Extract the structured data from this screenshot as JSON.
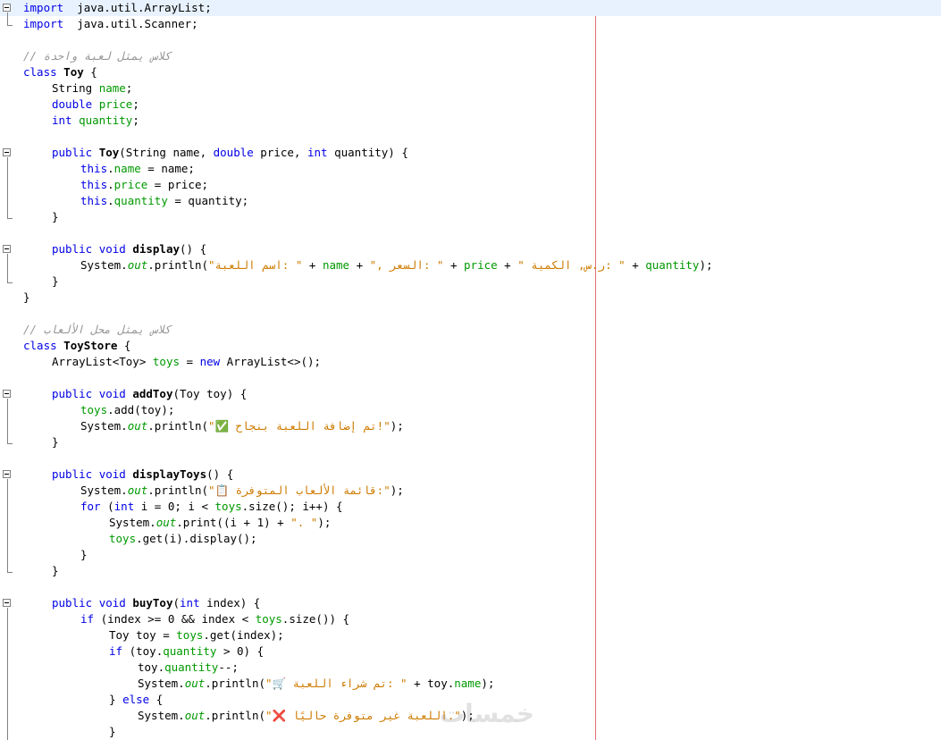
{
  "editor": {
    "lines": [
      {
        "indent": 0,
        "spans": [
          [
            "kw",
            "import"
          ],
          [
            "",
            "  java.util.ArrayList;"
          ]
        ]
      },
      {
        "indent": 0,
        "spans": [
          [
            "kw",
            "import"
          ],
          [
            "",
            "  java.util.Scanner;"
          ]
        ]
      },
      {
        "indent": 0,
        "spans": []
      },
      {
        "indent": 0,
        "spans": [
          [
            "cmt",
            "// كلاس يمثل لعبة واحدة"
          ]
        ]
      },
      {
        "indent": 0,
        "spans": [
          [
            "kw",
            "class"
          ],
          [
            "",
            " "
          ],
          [
            "b",
            "Toy"
          ],
          [
            "",
            " {"
          ]
        ]
      },
      {
        "indent": 1,
        "spans": [
          [
            "",
            "String "
          ],
          [
            "fld",
            "name"
          ],
          [
            "",
            ";"
          ]
        ]
      },
      {
        "indent": 1,
        "spans": [
          [
            "kw",
            "double"
          ],
          [
            "",
            " "
          ],
          [
            "fld",
            "price"
          ],
          [
            "",
            ";"
          ]
        ]
      },
      {
        "indent": 1,
        "spans": [
          [
            "kw",
            "int"
          ],
          [
            "",
            " "
          ],
          [
            "fld",
            "quantity"
          ],
          [
            "",
            ";"
          ]
        ]
      },
      {
        "indent": 0,
        "spans": []
      },
      {
        "indent": 1,
        "spans": [
          [
            "kw",
            "public"
          ],
          [
            "",
            " "
          ],
          [
            "b",
            "Toy"
          ],
          [
            "",
            "(String name, "
          ],
          [
            "kw",
            "double"
          ],
          [
            "",
            " price, "
          ],
          [
            "kw",
            "int"
          ],
          [
            "",
            " quantity) {"
          ]
        ]
      },
      {
        "indent": 2,
        "spans": [
          [
            "kw",
            "this"
          ],
          [
            "",
            "."
          ],
          [
            "fld",
            "name"
          ],
          [
            "",
            " = name;"
          ]
        ]
      },
      {
        "indent": 2,
        "spans": [
          [
            "kw",
            "this"
          ],
          [
            "",
            "."
          ],
          [
            "fld",
            "price"
          ],
          [
            "",
            " = price;"
          ]
        ]
      },
      {
        "indent": 2,
        "spans": [
          [
            "kw",
            "this"
          ],
          [
            "",
            "."
          ],
          [
            "fld",
            "quantity"
          ],
          [
            "",
            " = quantity;"
          ]
        ]
      },
      {
        "indent": 1,
        "spans": [
          [
            "",
            "}"
          ]
        ]
      },
      {
        "indent": 0,
        "spans": []
      },
      {
        "indent": 1,
        "spans": [
          [
            "kw",
            "public"
          ],
          [
            "",
            " "
          ],
          [
            "kw",
            "void"
          ],
          [
            "",
            " "
          ],
          [
            "b",
            "display"
          ],
          [
            "",
            "() {"
          ]
        ]
      },
      {
        "indent": 2,
        "spans": [
          [
            "",
            "System."
          ],
          [
            "sm",
            "out"
          ],
          [
            "",
            ".println("
          ],
          [
            "str",
            "\"اسم اللعبة: \""
          ],
          [
            "",
            " + "
          ],
          [
            "fld",
            "name"
          ],
          [
            "",
            " + "
          ],
          [
            "str",
            "\", السعر: \""
          ],
          [
            "",
            " + "
          ],
          [
            "fld",
            "price"
          ],
          [
            "",
            " + "
          ],
          [
            "str",
            "\" ر.س, الكمية: \""
          ],
          [
            "",
            " + "
          ],
          [
            "fld",
            "quantity"
          ],
          [
            "",
            ");"
          ]
        ]
      },
      {
        "indent": 1,
        "spans": [
          [
            "",
            "}"
          ]
        ]
      },
      {
        "indent": 0,
        "spans": [
          [
            "",
            "}"
          ]
        ]
      },
      {
        "indent": 0,
        "spans": []
      },
      {
        "indent": 0,
        "spans": [
          [
            "cmt",
            "// كلاس يمثل محل الألعاب"
          ]
        ]
      },
      {
        "indent": 0,
        "spans": [
          [
            "kw",
            "class"
          ],
          [
            "",
            " "
          ],
          [
            "b",
            "ToyStore"
          ],
          [
            "",
            " {"
          ]
        ]
      },
      {
        "indent": 1,
        "spans": [
          [
            "",
            "ArrayList<Toy> "
          ],
          [
            "fld",
            "toys"
          ],
          [
            "",
            " = "
          ],
          [
            "kw",
            "new"
          ],
          [
            "",
            " ArrayList<>();"
          ]
        ]
      },
      {
        "indent": 0,
        "spans": []
      },
      {
        "indent": 1,
        "spans": [
          [
            "kw",
            "public"
          ],
          [
            "",
            " "
          ],
          [
            "kw",
            "void"
          ],
          [
            "",
            " "
          ],
          [
            "b",
            "addToy"
          ],
          [
            "",
            "(Toy toy) {"
          ]
        ]
      },
      {
        "indent": 2,
        "spans": [
          [
            "fld",
            "toys"
          ],
          [
            "",
            ".add(toy);"
          ]
        ]
      },
      {
        "indent": 2,
        "spans": [
          [
            "",
            "System."
          ],
          [
            "sm",
            "out"
          ],
          [
            "",
            ".println("
          ],
          [
            "str",
            "\"✅ تم إضافة اللعبة بنجاح!\""
          ],
          [
            "",
            ");"
          ]
        ]
      },
      {
        "indent": 1,
        "spans": [
          [
            "",
            "}"
          ]
        ]
      },
      {
        "indent": 0,
        "spans": []
      },
      {
        "indent": 1,
        "spans": [
          [
            "kw",
            "public"
          ],
          [
            "",
            " "
          ],
          [
            "kw",
            "void"
          ],
          [
            "",
            " "
          ],
          [
            "b",
            "displayToys"
          ],
          [
            "",
            "() {"
          ]
        ]
      },
      {
        "indent": 2,
        "spans": [
          [
            "",
            "System."
          ],
          [
            "sm",
            "out"
          ],
          [
            "",
            ".println("
          ],
          [
            "str",
            "\"📋 قائمة الألعاب المتوفرة:\""
          ],
          [
            "",
            ");"
          ]
        ]
      },
      {
        "indent": 2,
        "spans": [
          [
            "kw",
            "for"
          ],
          [
            "",
            " ("
          ],
          [
            "kw",
            "int"
          ],
          [
            "",
            " i = 0; i < "
          ],
          [
            "fld",
            "toys"
          ],
          [
            "",
            ".size(); i++) {"
          ]
        ]
      },
      {
        "indent": 3,
        "spans": [
          [
            "",
            "System."
          ],
          [
            "sm",
            "out"
          ],
          [
            "",
            ".print((i + 1) + "
          ],
          [
            "str",
            "\". \""
          ],
          [
            "",
            ");"
          ]
        ]
      },
      {
        "indent": 3,
        "spans": [
          [
            "fld",
            "toys"
          ],
          [
            "",
            ".get(i).display();"
          ]
        ]
      },
      {
        "indent": 2,
        "spans": [
          [
            "",
            "}"
          ]
        ]
      },
      {
        "indent": 1,
        "spans": [
          [
            "",
            "}"
          ]
        ]
      },
      {
        "indent": 0,
        "spans": []
      },
      {
        "indent": 1,
        "spans": [
          [
            "kw",
            "public"
          ],
          [
            "",
            " "
          ],
          [
            "kw",
            "void"
          ],
          [
            "",
            " "
          ],
          [
            "b",
            "buyToy"
          ],
          [
            "",
            "("
          ],
          [
            "kw",
            "int"
          ],
          [
            "",
            " index) {"
          ]
        ]
      },
      {
        "indent": 2,
        "spans": [
          [
            "kw",
            "if"
          ],
          [
            "",
            " (index >= 0 && index < "
          ],
          [
            "fld",
            "toys"
          ],
          [
            "",
            ".size()) {"
          ]
        ]
      },
      {
        "indent": 3,
        "spans": [
          [
            "",
            "Toy toy = "
          ],
          [
            "fld",
            "toys"
          ],
          [
            "",
            ".get(index);"
          ]
        ]
      },
      {
        "indent": 3,
        "spans": [
          [
            "kw",
            "if"
          ],
          [
            "",
            " (toy."
          ],
          [
            "fld",
            "quantity"
          ],
          [
            "",
            " > 0) {"
          ]
        ]
      },
      {
        "indent": 4,
        "spans": [
          [
            "",
            "toy."
          ],
          [
            "fld",
            "quantity"
          ],
          [
            "",
            "--;"
          ]
        ]
      },
      {
        "indent": 4,
        "spans": [
          [
            "",
            "System."
          ],
          [
            "sm",
            "out"
          ],
          [
            "",
            ".println("
          ],
          [
            "str",
            "\"🛒 تم شراء اللعبة: \""
          ],
          [
            "",
            " + toy."
          ],
          [
            "fld",
            "name"
          ],
          [
            "",
            ");"
          ]
        ]
      },
      {
        "indent": 3,
        "spans": [
          [
            "",
            "} "
          ],
          [
            "kw",
            "else"
          ],
          [
            "",
            " {"
          ]
        ]
      },
      {
        "indent": 4,
        "spans": [
          [
            "",
            "System."
          ],
          [
            "sm",
            "out"
          ],
          [
            "",
            ".println("
          ],
          [
            "str",
            "\"❌ اللعبة غير متوفرة حاليًا.\""
          ],
          [
            "",
            ");"
          ]
        ]
      },
      {
        "indent": 3,
        "spans": [
          [
            "",
            "}"
          ]
        ]
      }
    ]
  },
  "watermark": "خمسات"
}
